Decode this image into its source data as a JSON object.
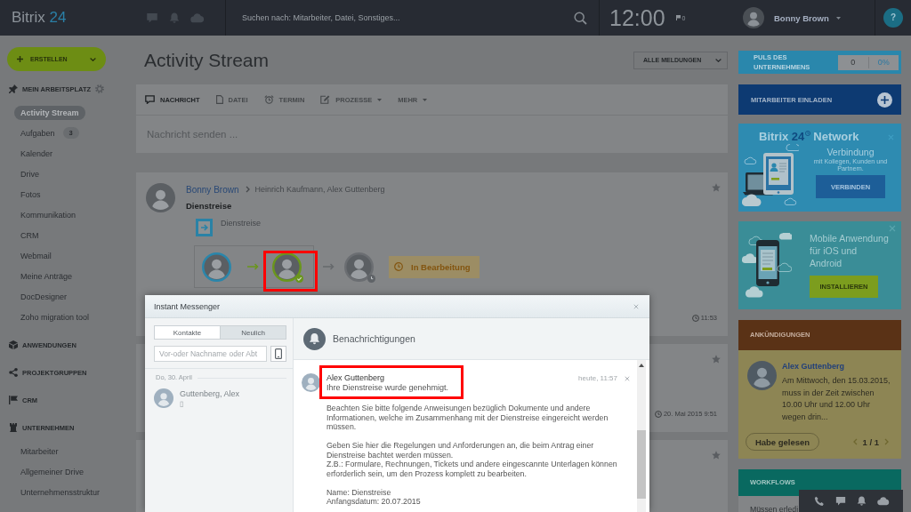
{
  "top_bar": {
    "logo": {
      "brand": "Bitrix",
      "number": "24"
    },
    "search": {
      "placeholder": "Suchen nach: Mitarbeiter, Datei, Sonstiges..."
    },
    "clock": "12:00",
    "flag_count": "0",
    "user": {
      "name": "Bonny Brown"
    },
    "help": "?"
  },
  "sidebar": {
    "create_button": "ERSTELLEN",
    "sections": [
      {
        "title": "MEIN ARBEITSPLATZ",
        "kind": "workplace",
        "settings": true,
        "items": [
          {
            "label": "Activity Stream",
            "selected": true
          },
          {
            "label": "Aufgaben",
            "selected": false,
            "badge": "3"
          },
          {
            "label": "Kalender",
            "selected": false
          },
          {
            "label": "Drive",
            "selected": false
          },
          {
            "label": "Fotos",
            "selected": false
          },
          {
            "label": "Kommunikation",
            "selected": false
          },
          {
            "label": "CRM",
            "selected": false
          },
          {
            "label": "Webmail",
            "selected": false
          },
          {
            "label": "Meine Anträge",
            "selected": false
          },
          {
            "label": "DocDesigner",
            "selected": false
          },
          {
            "label": "Zoho migration tool",
            "selected": false
          }
        ]
      },
      {
        "title": "ANWENDUNGEN",
        "kind": "apps",
        "settings": false
      },
      {
        "title": "PROJEKTGRUPPEN",
        "kind": "groups",
        "settings": false
      },
      {
        "title": "CRM",
        "kind": "crm",
        "settings": false
      },
      {
        "title": "UNTERNEHMEN",
        "kind": "company",
        "settings": false,
        "items": [
          {
            "label": "Mitarbeiter",
            "selected": false
          },
          {
            "label": "Allgemeiner Drive",
            "selected": false
          },
          {
            "label": "Unternehmensstruktur",
            "selected": false
          }
        ]
      }
    ]
  },
  "main": {
    "title": "Activity Stream",
    "filter": "ALLE MELDUNGEN",
    "composer": {
      "tabs": [
        {
          "label": "NACHRICHT",
          "kind": "message",
          "selected": true,
          "dropdown": false
        },
        {
          "label": "DATEI",
          "kind": "file",
          "selected": false,
          "dropdown": false
        },
        {
          "label": "TERMIN",
          "kind": "event",
          "selected": false,
          "dropdown": false
        },
        {
          "label": "PROZESSE",
          "kind": "process",
          "selected": false,
          "dropdown": true
        },
        {
          "label": "MEHR",
          "kind": "more",
          "selected": false,
          "dropdown": true
        }
      ],
      "placeholder": "Nachricht senden ..."
    },
    "posts": [
      {
        "author": "Bonny Brown",
        "recipients": "Heinrich Kaufmann, Alex Guttenberg",
        "title": "Dienstreise",
        "attachment": "Dienstreise",
        "workflow": {
          "steps": [
            {
              "kind": "author",
              "highlighted": false
            },
            {
              "kind": "approved",
              "highlighted": true
            },
            {
              "kind": "pending",
              "highlighted": false
            }
          ],
          "state": "In Bearbeitung"
        },
        "time": "11:53",
        "starred": false
      },
      {
        "time": "20. Mai 2015 9:51",
        "starred": false
      },
      {
        "starred": false
      }
    ]
  },
  "messenger": {
    "title": "Instant Messenger",
    "tabs": [
      {
        "label": "Kontakte",
        "selected": false
      },
      {
        "label": "Neulich",
        "selected": true
      }
    ],
    "search": {
      "placeholder": "Vor-oder Nachname oder Abt"
    },
    "recent": [
      {
        "date": "Do, 30. April",
        "contacts": [
          {
            "name": "Guttenberg, Alex",
            "status": "▯"
          }
        ]
      }
    ],
    "panel": {
      "title": "Benachrichtigungen"
    },
    "notifications": [
      {
        "sender": "Alex Guttenberg",
        "summary": "Ihre Dienstreise wurde genehmigt.",
        "time": "heute, 11:57",
        "highlighted": true,
        "body": [
          "Beachten Sie bitte folgende Anweisungen bezüglich Dokumente und andere\nInformationen, welche im Zusammenhang mit der Dienstreise eingereicht werden\nmüssen.",
          "Geben Sie hier die Regelungen und Anforderungen an, die beim Antrag einer\nDienstreise bachtet werden müssen.\nZ.B.: Formulare, Rechnungen, Tickets und andere eingescannte Unterlagen können\nerforderlich sein, um den Prozess komplett zu bearbeiten.",
          "Name: Dienstreise\nAnfangsdatum: 20.07.2015"
        ]
      }
    ]
  },
  "right_panel": {
    "pulse": {
      "title": "PULS DES UNTERNEHMENS",
      "count": "0",
      "percent": "0%"
    },
    "invite": {
      "label": "MITARBEITER EINLADEN"
    },
    "network": {
      "title": {
        "brand": "Bitrix",
        "number": "24",
        "suffix": "Network"
      },
      "heading": "Verbindung",
      "text": "mit Kollegen, Kunden und Partnern.",
      "button": "VERBINDEN"
    },
    "mobile": {
      "title": "Mobile Anwendung",
      "text": "für iOS und Android",
      "button": "INSTALLIEREN"
    },
    "announcements": {
      "title": "ANKÜNDIGUNGEN",
      "author": "Alex Guttenberg",
      "text": "Am Mittwoch, den 15.03.2015, muss in der Zeit zwischen 10.00 Uhr und 12.00 Uhr wegen drin...",
      "button": "Habe gelesen",
      "pager": "1 / 1"
    },
    "workflows": {
      "title": "WORKFLOWS",
      "text": "Müssen erledi"
    }
  }
}
